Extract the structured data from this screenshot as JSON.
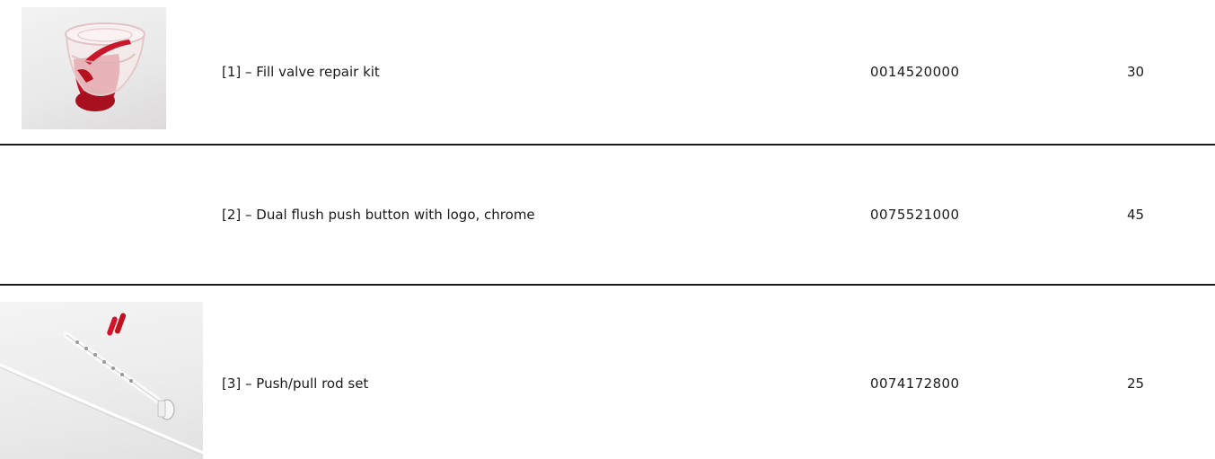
{
  "parts": [
    {
      "description": "[1] – Fill valve repair kit",
      "part_number": "0014520000",
      "price": "30",
      "image": "fill-valve-seal-photo"
    },
    {
      "description": "[2] – Dual flush push button with logo, chrome",
      "part_number": "0075521000",
      "price": "45",
      "image": ""
    },
    {
      "description": "[3] – Push/pull rod set",
      "part_number": "0074172800",
      "price": "25",
      "image": "push-pull-rod-photo"
    }
  ],
  "colors": {
    "divider": "#1a1a1a",
    "text": "#1a1a1a",
    "seal_red": "#c8162b"
  }
}
